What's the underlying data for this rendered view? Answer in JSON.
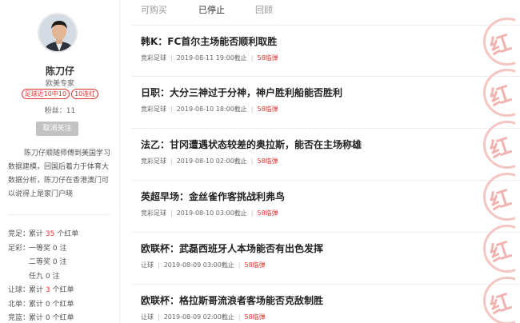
{
  "expert": {
    "name": "陈刀仔",
    "title": "欧美专家",
    "badge_recent": "足球近10中10",
    "badge_streak": "10连红",
    "fans": "粉丝：11",
    "follow_button": "取消关注",
    "intro": "陈刀仔顺随师傅到美国学习数据建模，回国后着力于体育大数据分析，陈刀仔在香港澳门可以说得上是家门户晓"
  },
  "stats": [
    {
      "label": "竞足：",
      "pre": "累计 ",
      "num": "35",
      "post": " 个红单",
      "num_red": true
    },
    {
      "label": "足彩：",
      "pre": "一等奖 0 注",
      "num": "",
      "post": "",
      "num_red": false
    },
    {
      "label": "",
      "pre": "二等奖 0 注",
      "num": "",
      "post": "",
      "num_red": false
    },
    {
      "label": "",
      "pre": "任九 0 注",
      "num": "",
      "post": "",
      "num_red": false
    },
    {
      "label": "让球：",
      "pre": "累计 ",
      "num": "3",
      "post": " 个红单",
      "num_red": true
    },
    {
      "label": "北单：",
      "pre": "累计 0 个红单",
      "num": "",
      "post": "",
      "num_red": false
    },
    {
      "label": "竞篮：",
      "pre": "累计 0 个红单",
      "num": "",
      "post": "",
      "num_red": false
    }
  ],
  "tabs": [
    {
      "label": "可购买",
      "active": false
    },
    {
      "label": "已停止",
      "active": true
    },
    {
      "label": "回顾",
      "active": false
    }
  ],
  "articles": [
    {
      "title": "韩K：FC首尔主场能否顺利取胜",
      "type": "竞彩足球",
      "time": "2019-08-11 19:00截止",
      "count": "58临弹",
      "stamp": "红"
    },
    {
      "title": "日职：大分三神过于分神，神户胜利船能否胜利",
      "type": "竞彩足球",
      "time": "2019-08-10 18:00截止",
      "count": "58临弹",
      "stamp": "红"
    },
    {
      "title": "法乙：甘冈遭遇状态较差的奥拉斯，能否在主场称雄",
      "type": "竞彩足球",
      "time": "2019-08-10 02:00截止",
      "count": "58临弹",
      "stamp": "红"
    },
    {
      "title": "英超早场：金丝雀作客挑战利弗鸟",
      "type": "竞彩足球",
      "time": "2019-08-10 03:00截止",
      "count": "58临弹",
      "stamp": "红"
    },
    {
      "title": "欧联杯：武磊西班牙人本场能否有出色发挥",
      "type": "让球",
      "time": "2019-08-09 03:00截止",
      "count": "58临弹",
      "stamp": "红"
    },
    {
      "title": "欧联杯：格拉斯哥流浪者客场能否克敌制胜",
      "type": "让球",
      "time": "2019-08-09 02:00截止",
      "count": "58临弹",
      "stamp": "红"
    }
  ],
  "colors": {
    "accent": "#e0322e",
    "stamp": "#f1b3b0"
  }
}
